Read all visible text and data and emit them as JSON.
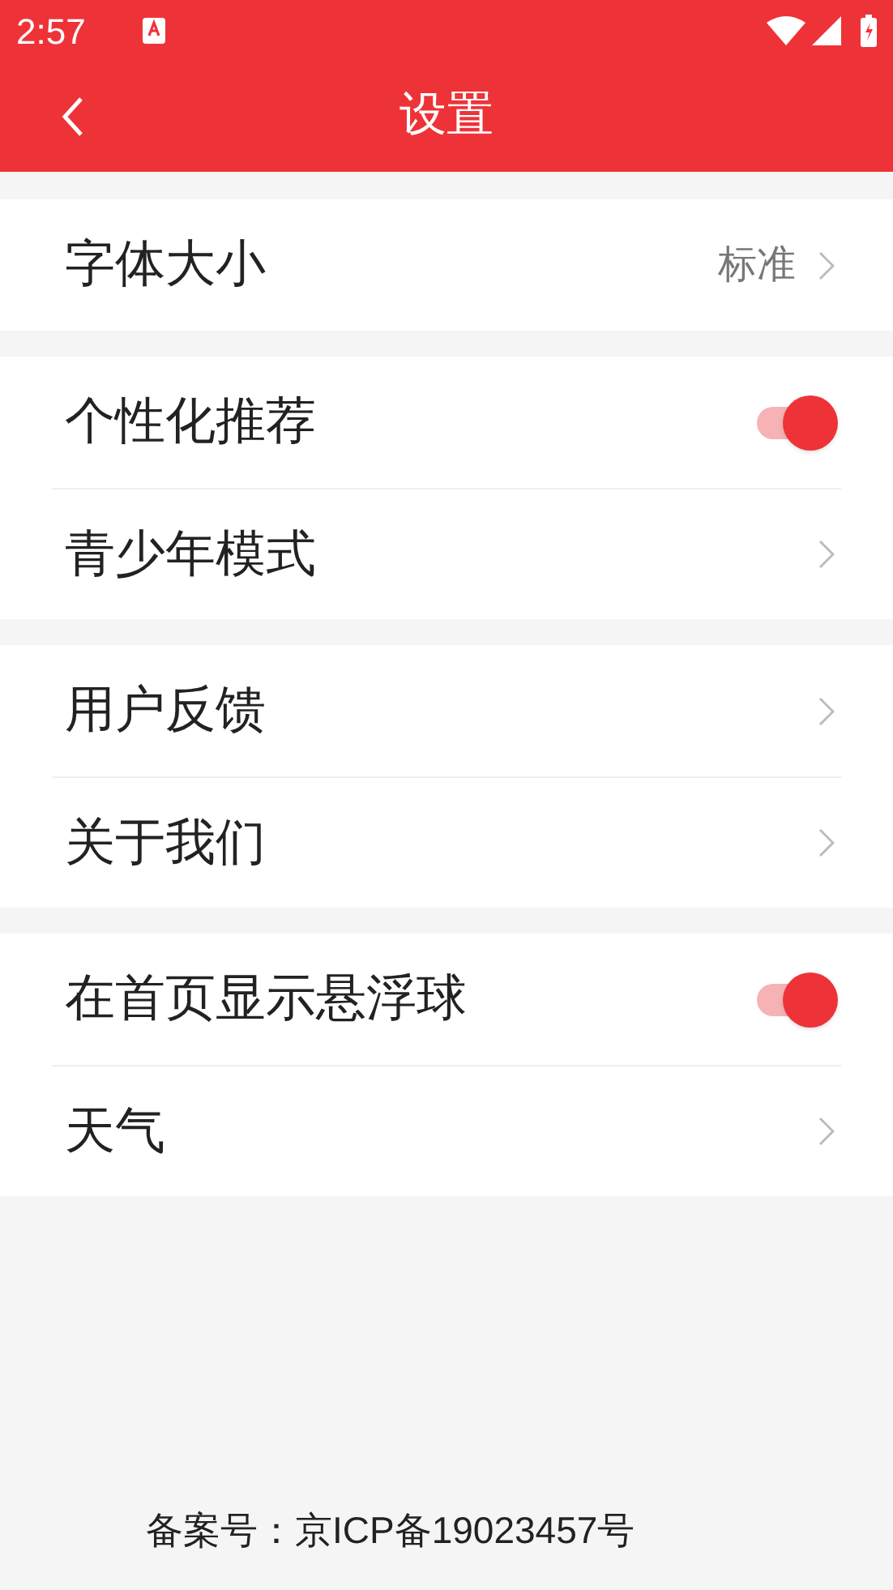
{
  "status_bar": {
    "time": "2:57"
  },
  "header": {
    "title": "设置"
  },
  "groups": [
    {
      "rows": [
        {
          "kind": "value",
          "label": "字体大小",
          "value": "标准"
        }
      ]
    },
    {
      "rows": [
        {
          "kind": "toggle",
          "label": "个性化推荐",
          "on": true
        },
        {
          "kind": "link",
          "label": "青少年模式"
        }
      ]
    },
    {
      "rows": [
        {
          "kind": "link",
          "label": "用户反馈"
        },
        {
          "kind": "link",
          "label": "关于我们"
        }
      ]
    },
    {
      "rows": [
        {
          "kind": "toggle",
          "label": "在首页显示悬浮球",
          "on": true
        },
        {
          "kind": "link",
          "label": "天气"
        }
      ]
    }
  ],
  "footer": {
    "text": "备案号：京ICP备19023457号"
  }
}
